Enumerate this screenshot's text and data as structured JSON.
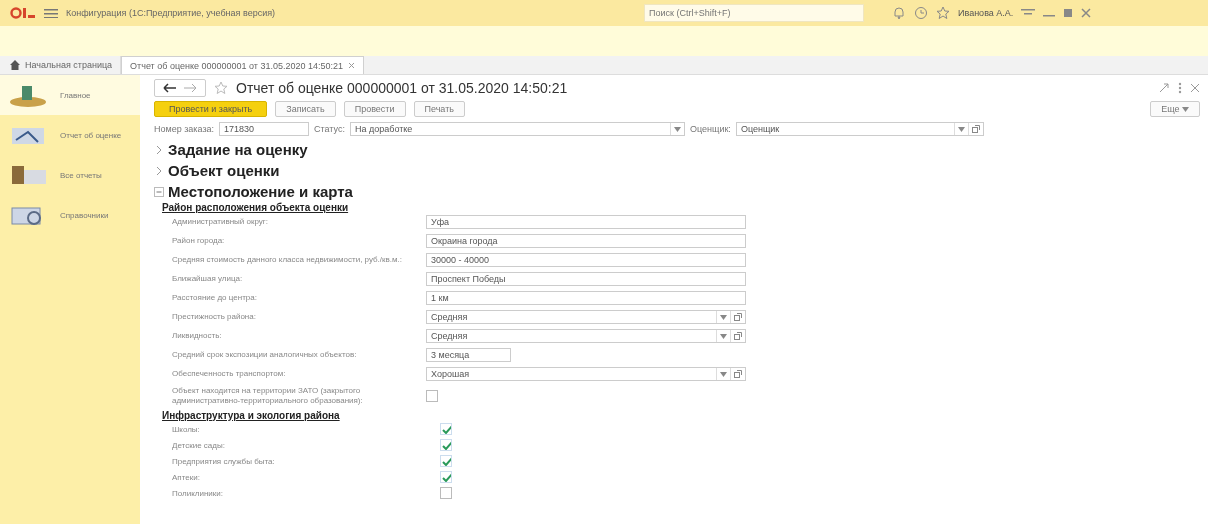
{
  "window": {
    "title": "Конфигурация (1С:Предприятие, учебная версия)",
    "search": {
      "placeholder": "Поиск (Ctrl+Shift+F)"
    },
    "user": "Иванова А.А."
  },
  "tabs": [
    {
      "label": "Начальная страница",
      "kind": "home",
      "selected": false
    },
    {
      "label": "Отчет об оценке 000000001 от 31.05.2020 14:50:21",
      "kind": "doc",
      "selected": true
    }
  ],
  "sidebar": {
    "items": [
      {
        "label": "Главное",
        "selected": true
      },
      {
        "label": "Отчет об оценке",
        "selected": false
      },
      {
        "label": "Все отчеты",
        "selected": false
      },
      {
        "label": "Справочники",
        "selected": false
      }
    ]
  },
  "document": {
    "title": "Отчет об оценке 000000001 от 31.05.2020 14:50:21",
    "buttons": [
      {
        "label": "Провести и закрыть",
        "kind": "primary"
      },
      {
        "label": "Записать",
        "kind": "normal"
      },
      {
        "label": "Провести",
        "kind": "normal"
      },
      {
        "label": "Печать",
        "kind": "normal"
      }
    ],
    "more": "Еще",
    "header_fields": [
      {
        "label": "Номер заказа:",
        "value": "171830",
        "kind": "text"
      },
      {
        "label": "Статус:",
        "value": "На доработке",
        "kind": "select"
      },
      {
        "label": "Оценщик:",
        "value": "Оценщик",
        "kind": "lookup"
      }
    ],
    "sections": [
      {
        "title": "Задание на оценку",
        "expanded": false
      },
      {
        "title": "Объект оценки",
        "expanded": false
      },
      {
        "title": "Местоположение и карта",
        "expanded": true
      }
    ],
    "location": {
      "title": "Район расположения объекта оценки",
      "fields": [
        {
          "label": "Административный округ:",
          "value": "Уфа",
          "kind": "text"
        },
        {
          "label": "Район города:",
          "value": "Окраина города",
          "kind": "text"
        },
        {
          "label": "Средняя стоимость данного класса недвижимости, руб./кв.м.:",
          "value": "30000 - 40000",
          "kind": "text"
        },
        {
          "label": "Ближайшая улица:",
          "value": "Проспект Победы",
          "kind": "text"
        },
        {
          "label": "Расстояние до центра:",
          "value": "1 км",
          "kind": "text"
        },
        {
          "label": "Престижность района:",
          "value": "Средняя",
          "kind": "lookup"
        },
        {
          "label": "Ликвидность:",
          "value": "Средняя",
          "kind": "lookup"
        },
        {
          "label": "Средний срок экспозиции аналогичных объектов:",
          "value": "3 месяца",
          "kind": "short"
        },
        {
          "label": "Обеспеченность транспортом:",
          "value": "Хорошая",
          "kind": "lookup"
        },
        {
          "label": "Объект находится на территории ЗАТО (закрытого административно-территориального образования):",
          "checked": false,
          "kind": "check"
        }
      ]
    },
    "infrastructure": {
      "title": "Инфраструктура и экология района",
      "items": [
        {
          "label": "Школы:",
          "checked": true
        },
        {
          "label": "Детские сады:",
          "checked": true
        },
        {
          "label": "Предприятия службы быта:",
          "checked": true
        },
        {
          "label": "Аптеки:",
          "checked": true
        },
        {
          "label": "Поликлиники:",
          "checked": false
        }
      ]
    }
  }
}
